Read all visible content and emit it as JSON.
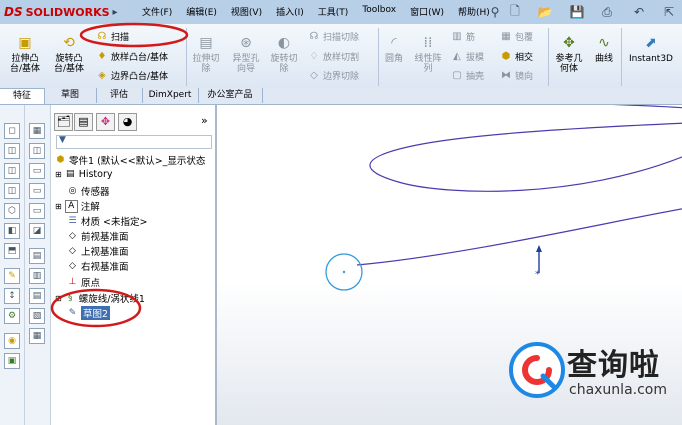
{
  "app": {
    "logo_prefix": "DS",
    "logo_name": "SOLIDWORKS"
  },
  "menu": [
    "文件(F)",
    "编辑(E)",
    "视图(V)",
    "插入(I)",
    "工具(T)",
    "Toolbox",
    "窗口(W)",
    "帮助(H)"
  ],
  "ribbon": {
    "extrude_boss": "拉伸凸\n台/基体",
    "revolve_boss": "旋转凸\n台/基体",
    "sweep": "扫描",
    "loft_boss": "放样凸台/基体",
    "boundary_boss": "边界凸台/基体",
    "extrude_cut": "拉伸切\n除",
    "hole_wizard": "异型孔\n向导",
    "revolve_cut": "旋转切\n除",
    "sweep_cut": "扫描切除",
    "loft_cut": "放样切割",
    "boundary_cut": "边界切除",
    "fillet": "圆角",
    "linear_pattern": "线性阵\n列",
    "rib": "筋",
    "draft": "拔模",
    "shell": "抽壳",
    "wrap": "包覆",
    "intersect": "相交",
    "mirror": "镜向",
    "ref_geometry": "参考几\n何体",
    "curves": "曲线",
    "instant3d": "Instant3D"
  },
  "tabs": [
    "特征",
    "草图",
    "评估",
    "DimXpert",
    "办公室产品"
  ],
  "tree": {
    "part": "零件1 (默认<<默认>_显示状态",
    "items": [
      "History",
      "传感器",
      "注解",
      "材质 <未指定>",
      "前视基准面",
      "上视基准面",
      "右视基准面",
      "原点",
      "螺旋线/涡状线1",
      "草图2"
    ]
  },
  "watermark": {
    "title": "查询啦",
    "url": "chaxunla.com"
  },
  "colors": {
    "highlight": "#d11a1a",
    "curve": "#4b3bb0",
    "brand": "#c00000"
  }
}
